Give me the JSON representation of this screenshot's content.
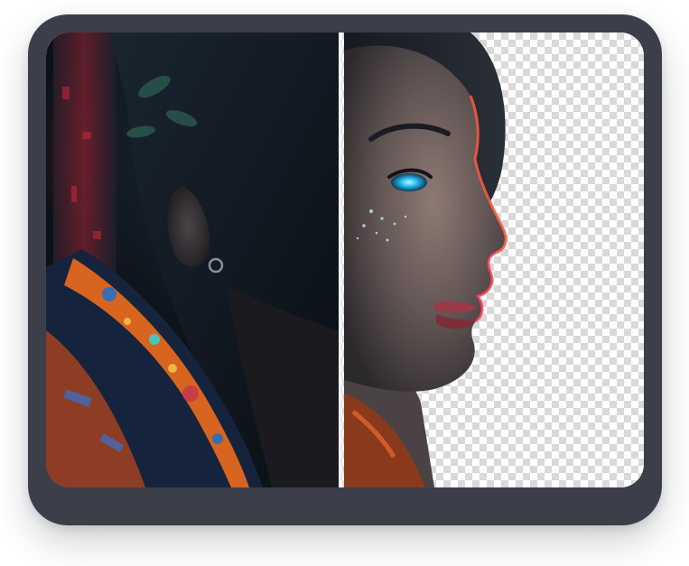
{
  "comparison": {
    "before_label": "",
    "after_label": "",
    "split_fraction": 0.49
  },
  "colors": {
    "frame": "#3c3f4a",
    "divider": "#f5f5f5",
    "checker_light": "#ffffff",
    "checker_dark": "#d9d9d9",
    "accent_eye": "#2ec5ff",
    "jacket_orange": "#e0652a",
    "jacket_blue": "#1f5fa8"
  },
  "icons": {
    "divider_handle": "split-handle-icon"
  }
}
